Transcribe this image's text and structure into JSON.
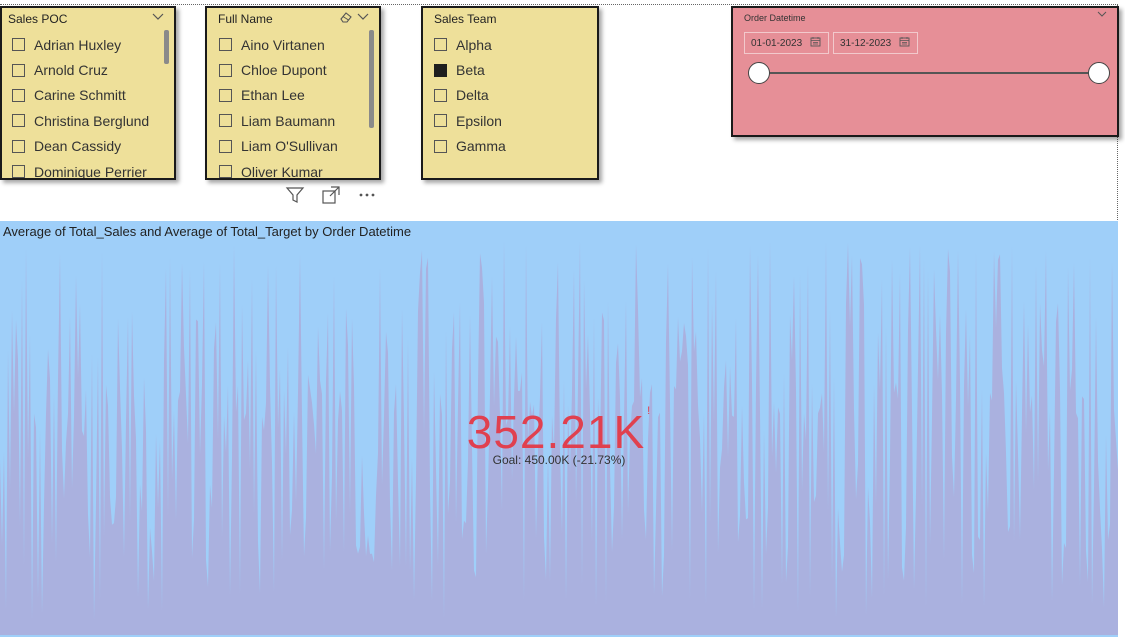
{
  "slicers": {
    "sales_poc": {
      "title": "Sales POC",
      "items": [
        {
          "label": "Adrian Huxley",
          "checked": false
        },
        {
          "label": "Arnold Cruz",
          "checked": false
        },
        {
          "label": "Carine Schmitt",
          "checked": false
        },
        {
          "label": "Christina Berglund",
          "checked": false
        },
        {
          "label": "Dean Cassidy",
          "checked": false
        },
        {
          "label": "Dominique Perrier",
          "checked": false
        }
      ]
    },
    "full_name": {
      "title": "Full Name",
      "items": [
        {
          "label": "Aino Virtanen",
          "checked": false
        },
        {
          "label": "Chloe Dupont",
          "checked": false
        },
        {
          "label": "Ethan Lee",
          "checked": false
        },
        {
          "label": "Liam Baumann",
          "checked": false
        },
        {
          "label": "Liam O'Sullivan",
          "checked": false
        },
        {
          "label": "Oliver Kumar",
          "checked": false
        }
      ]
    },
    "sales_team": {
      "title": "Sales Team",
      "items": [
        {
          "label": "Alpha",
          "checked": false
        },
        {
          "label": "Beta",
          "checked": true
        },
        {
          "label": "Delta",
          "checked": false
        },
        {
          "label": "Epsilon",
          "checked": false
        },
        {
          "label": "Gamma",
          "checked": false
        }
      ]
    }
  },
  "date_slicer": {
    "title": "Order Datetime",
    "start": "01-01-2023",
    "end": "31-12-2023"
  },
  "visual_header_icons": [
    "filter-icon",
    "focus-mode-icon",
    "more-options-icon"
  ],
  "chart": {
    "title": "Average of Total_Sales and Average of Total_Target by Order Datetime",
    "kpi_value": "352.21K",
    "kpi_flag": "!",
    "goal_text": "Goal: 450.00K (-21.73%)"
  },
  "colors": {
    "slicer_bg": "#eee09a",
    "date_card_bg": "#e68f97",
    "chart_bg": "#9fcff9",
    "area_fill": "#aab1df",
    "kpi_red": "#e0404f"
  },
  "chart_data": {
    "type": "area",
    "x_label": "Order Datetime",
    "series": [
      {
        "name": "Average of Total_Sales"
      },
      {
        "name": "Average of Total_Target"
      }
    ],
    "kpi": {
      "value": "352.21K",
      "goal": "450.00K",
      "delta": "-21.73%"
    }
  }
}
